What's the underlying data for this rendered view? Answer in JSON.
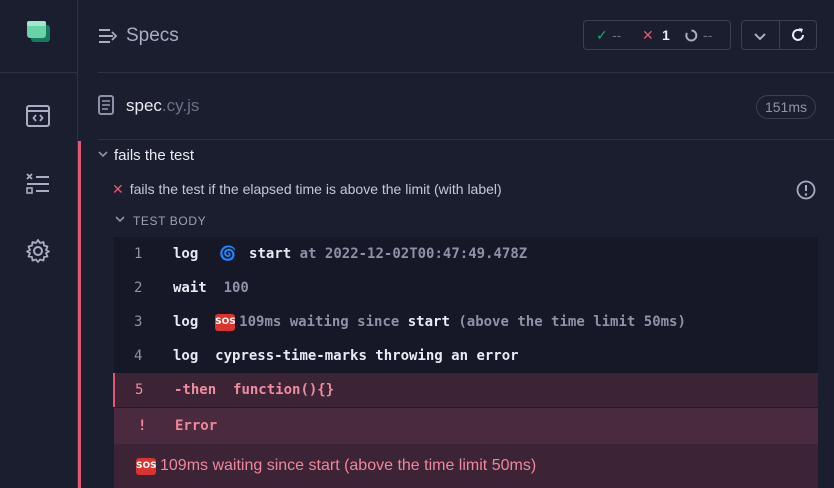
{
  "header": {
    "title": "Specs"
  },
  "stats": {
    "passed": "--",
    "failed": "1",
    "pending": "--"
  },
  "spec": {
    "name": "spec",
    "ext": ".cy.js",
    "duration": "151ms"
  },
  "suite": {
    "title": "fails the test"
  },
  "test": {
    "title": "fails the test if the elapsed time is above the limit (with label)",
    "section": "TEST BODY"
  },
  "commands": [
    {
      "num": "1",
      "name": "log",
      "parts": {
        "icon": "🌀",
        "bold": "start",
        "rest": "at 2022-12-02T00:47:49.478Z"
      }
    },
    {
      "num": "2",
      "name": "wait",
      "parts": {
        "value": "100"
      }
    },
    {
      "num": "3",
      "name": "log",
      "parts": {
        "icon": "SOS",
        "a": "109ms waiting since",
        "bold": "start",
        "rest": "(above the time limit 50ms)"
      }
    },
    {
      "num": "4",
      "name": "log",
      "parts": {
        "value": "cypress-time-marks throwing an error"
      }
    },
    {
      "num": "5",
      "name": "-then",
      "parts": {
        "value": "function(){}"
      }
    }
  ],
  "error": {
    "marker": "!",
    "label": "Error",
    "icon": "SOS",
    "message": "109ms waiting since start (above the time limit 50ms)"
  },
  "colors": {
    "bg": "#1b1e2e",
    "fail": "#e45770",
    "pass": "#1fa971",
    "errorText": "#f0869b"
  }
}
